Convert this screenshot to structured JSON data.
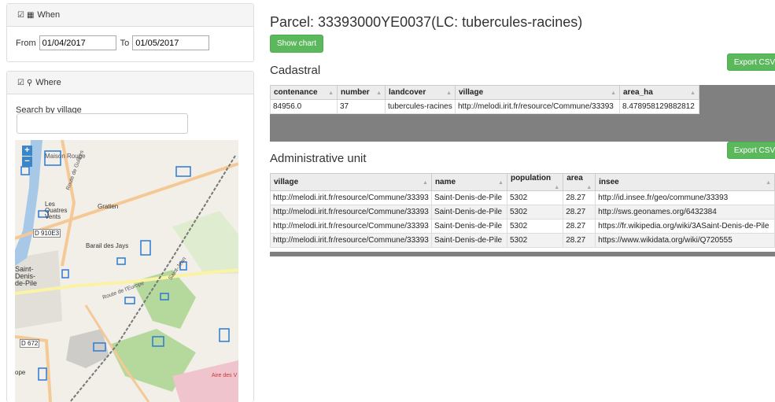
{
  "when": {
    "heading": "When",
    "from_label": "From",
    "from_value": "01/04/2017",
    "to_label": "To",
    "to_value": "01/05/2017"
  },
  "where": {
    "heading": "Where",
    "search_label": "Search by village",
    "search_value": ""
  },
  "map": {
    "zoom_in": "+",
    "zoom_out": "−",
    "labels": [
      "Maison Rouge",
      "Les Quatres Vents",
      "Gratien",
      "D 910E3",
      "Barail des Jays",
      "Saint-Denis-de-Pile",
      "Route de l'Europe",
      "D 672",
      "Aire des V",
      "ope",
      "Route de Guîtres",
      "Saint-Jean"
    ]
  },
  "main": {
    "title": "Parcel: 33393000YE0037(LC: tubercules-racines)",
    "show_chart": "Show chart",
    "export_csv": "Export CSV"
  },
  "cadastral": {
    "heading": "Cadastral",
    "columns": [
      "contenance",
      "number",
      "landcover",
      "village",
      "area_ha"
    ],
    "rows": [
      [
        "84956.0",
        "37",
        "tubercules-racines",
        "http://melodi.irit.fr/resource/Commune/33393",
        "8.478958129882812"
      ]
    ]
  },
  "admin": {
    "heading": "Administrative unit",
    "columns": [
      "village",
      "name",
      "population",
      "area",
      "insee"
    ],
    "rows": [
      [
        "http://melodi.irit.fr/resource/Commune/33393",
        "Saint-Denis-de-Pile",
        "5302",
        "28.27",
        "http://id.insee.fr/geo/commune/33393"
      ],
      [
        "http://melodi.irit.fr/resource/Commune/33393",
        "Saint-Denis-de-Pile",
        "5302",
        "28.27",
        "http://sws.geonames.org/6432384"
      ],
      [
        "http://melodi.irit.fr/resource/Commune/33393",
        "Saint-Denis-de-Pile",
        "5302",
        "28.27",
        "https://fr.wikipedia.org/wiki/3ASaint-Denis-de-Pile"
      ],
      [
        "http://melodi.irit.fr/resource/Commune/33393",
        "Saint-Denis-de-Pile",
        "5302",
        "28.27",
        "https://www.wikidata.org/wiki/Q720555"
      ]
    ]
  },
  "icons": {
    "checkbox": "checkbox-checked-icon",
    "calendar": "calendar-icon",
    "marker": "map-marker-icon",
    "sort": "sort-icon"
  },
  "colors": {
    "button_green": "#5cb85c",
    "map_water": "#a8c8e8",
    "map_forest": "#b5d99c",
    "parcel": "#2a7bd4"
  }
}
